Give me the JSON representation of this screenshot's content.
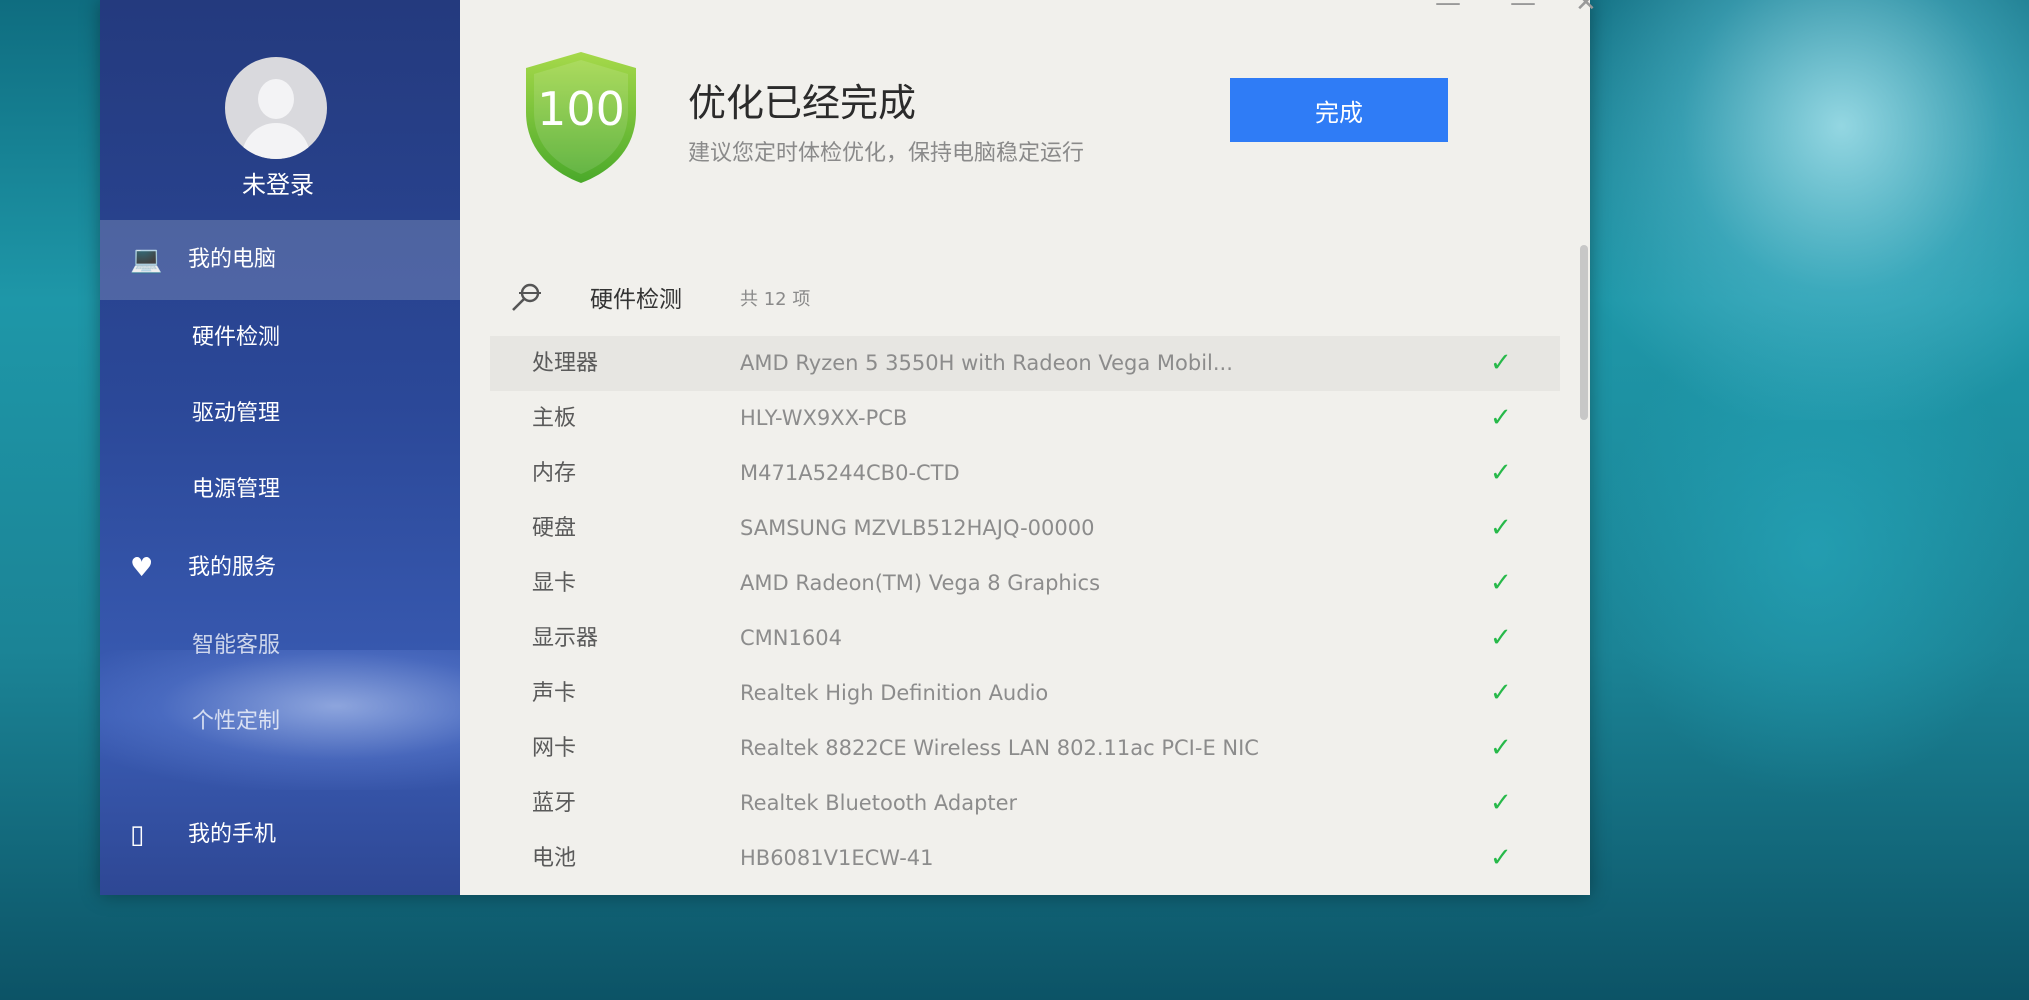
{
  "sidebar": {
    "login_label": "未登录",
    "groups": [
      {
        "icon": "laptop-icon",
        "label": "我的电脑",
        "active": true,
        "items": [
          "硬件检测",
          "驱动管理",
          "电源管理"
        ]
      },
      {
        "icon": "heart-icon",
        "label": "我的服务",
        "items": [
          "智能客服",
          "个性定制"
        ]
      },
      {
        "icon": "phone-icon",
        "label": "我的手机"
      }
    ]
  },
  "header": {
    "score": "100",
    "title": "优化已经完成",
    "subtitle": "建议您定时体检优化，保持电脑稳定运行",
    "done_label": "完成"
  },
  "hardware": {
    "section_title": "硬件检测",
    "count_label": "共 12 项",
    "rows": [
      {
        "category": "处理器",
        "value": "AMD Ryzen 5 3550H with Radeon Vega Mobil...",
        "status": "ok"
      },
      {
        "category": "主板",
        "value": "HLY-WX9XX-PCB",
        "status": "ok"
      },
      {
        "category": "内存",
        "value": "M471A5244CB0-CTD",
        "status": "ok"
      },
      {
        "category": "硬盘",
        "value": "SAMSUNG MZVLB512HAJQ-00000",
        "status": "ok"
      },
      {
        "category": "显卡",
        "value": "AMD Radeon(TM) Vega 8 Graphics",
        "status": "ok"
      },
      {
        "category": "显示器",
        "value": "CMN1604",
        "status": "ok"
      },
      {
        "category": "声卡",
        "value": "Realtek High Definition Audio",
        "status": "ok"
      },
      {
        "category": "网卡",
        "value": "Realtek 8822CE Wireless LAN 802.11ac PCI-E NIC",
        "status": "ok"
      },
      {
        "category": "蓝牙",
        "value": "Realtek Bluetooth Adapter",
        "status": "ok"
      },
      {
        "category": "电池",
        "value": "HB6081V1ECW-41",
        "status": "ok"
      }
    ]
  },
  "colors": {
    "accent": "#2f7cf6",
    "check": "#27b94a",
    "shield": "#7cc23a",
    "sidebar": "#2b4898"
  }
}
